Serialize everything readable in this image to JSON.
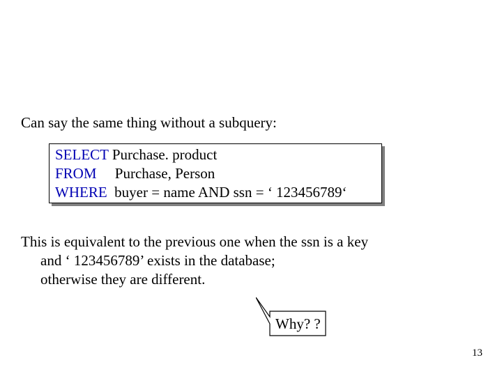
{
  "intro": "Can say the same thing without a subquery:",
  "sql": {
    "kw_select": "SELECT",
    "select_cols": " Purchase. product",
    "kw_from": "FROM",
    "from_tables": "     Purchase, Person",
    "kw_where": "WHERE",
    "where_clause": "  buyer = name AND ssn = ‘ 123456789‘"
  },
  "explain": {
    "line1": "This is equivalent to the previous one when the ssn is a key",
    "line2": "and ‘ 123456789’ exists in the database;",
    "line3": "otherwise they are different."
  },
  "callout": "Why? ?",
  "pagenum": "13"
}
